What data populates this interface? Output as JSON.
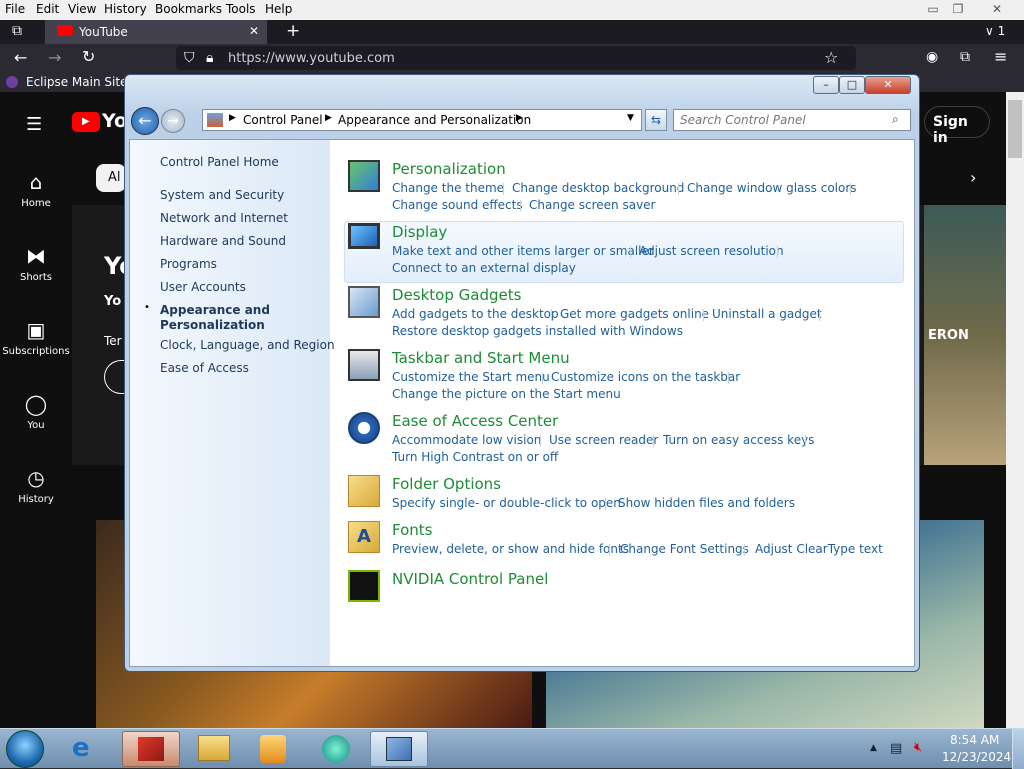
{
  "firefox": {
    "menu": [
      "File",
      "Edit",
      "View",
      "History",
      "Bookmarks",
      "Tools",
      "Help"
    ],
    "tab_title": "YouTube",
    "url": "https://www.youtube.com",
    "bookmark": "Eclipse Main Site",
    "tab_count": "1"
  },
  "youtube": {
    "logo_text": "Yo",
    "signin": "Sign in",
    "sidebar": [
      "Home",
      "Shorts",
      "Subscriptions",
      "You",
      "History"
    ],
    "chip_fragment": "Al",
    "hero_fragments": {
      "big": "Yo",
      "sub": "Yo",
      "body": "Ter"
    },
    "hero_game_text": "ERON"
  },
  "control_panel": {
    "breadcrumb": [
      "Control Panel",
      "Appearance and Personalization"
    ],
    "search_placeholder": "Search Control Panel",
    "left_links": {
      "home": "Control Panel Home",
      "items": [
        "System and Security",
        "Network and Internet",
        "Hardware and Sound",
        "Programs",
        "User Accounts"
      ],
      "selected": "Appearance and Personalization",
      "items_after": [
        "Clock, Language, and Region",
        "Ease of Access"
      ]
    },
    "categories": [
      {
        "title": "Personalization",
        "links": [
          "Change the theme",
          "Change desktop background",
          "Change window glass colors",
          "Change sound effects",
          "Change screen saver"
        ]
      },
      {
        "title": "Display",
        "links": [
          "Make text and other items larger or smaller",
          "Adjust screen resolution",
          "Connect to an external display"
        ]
      },
      {
        "title": "Desktop Gadgets",
        "links": [
          "Add gadgets to the desktop",
          "Get more gadgets online",
          "Uninstall a gadget",
          "Restore desktop gadgets installed with Windows"
        ]
      },
      {
        "title": "Taskbar and Start Menu",
        "links": [
          "Customize the Start menu",
          "Customize icons on the taskbar",
          "Change the picture on the Start menu"
        ]
      },
      {
        "title": "Ease of Access Center",
        "links": [
          "Accommodate low vision",
          "Use screen reader",
          "Turn on easy access keys",
          "Turn High Contrast on or off"
        ]
      },
      {
        "title": "Folder Options",
        "links": [
          "Specify single- or double-click to open",
          "Show hidden files and folders"
        ]
      },
      {
        "title": "Fonts",
        "links": [
          "Preview, delete, or show and hide fonts",
          "Change Font Settings",
          "Adjust ClearType text"
        ]
      },
      {
        "title": "NVIDIA Control Panel",
        "links": []
      }
    ]
  },
  "taskbar": {
    "time": "8:54 AM",
    "date": "12/23/2024"
  },
  "colors": {
    "category_title": "#1e8b36",
    "task_link": "#1f5f99",
    "yt_red": "#ff0000"
  }
}
